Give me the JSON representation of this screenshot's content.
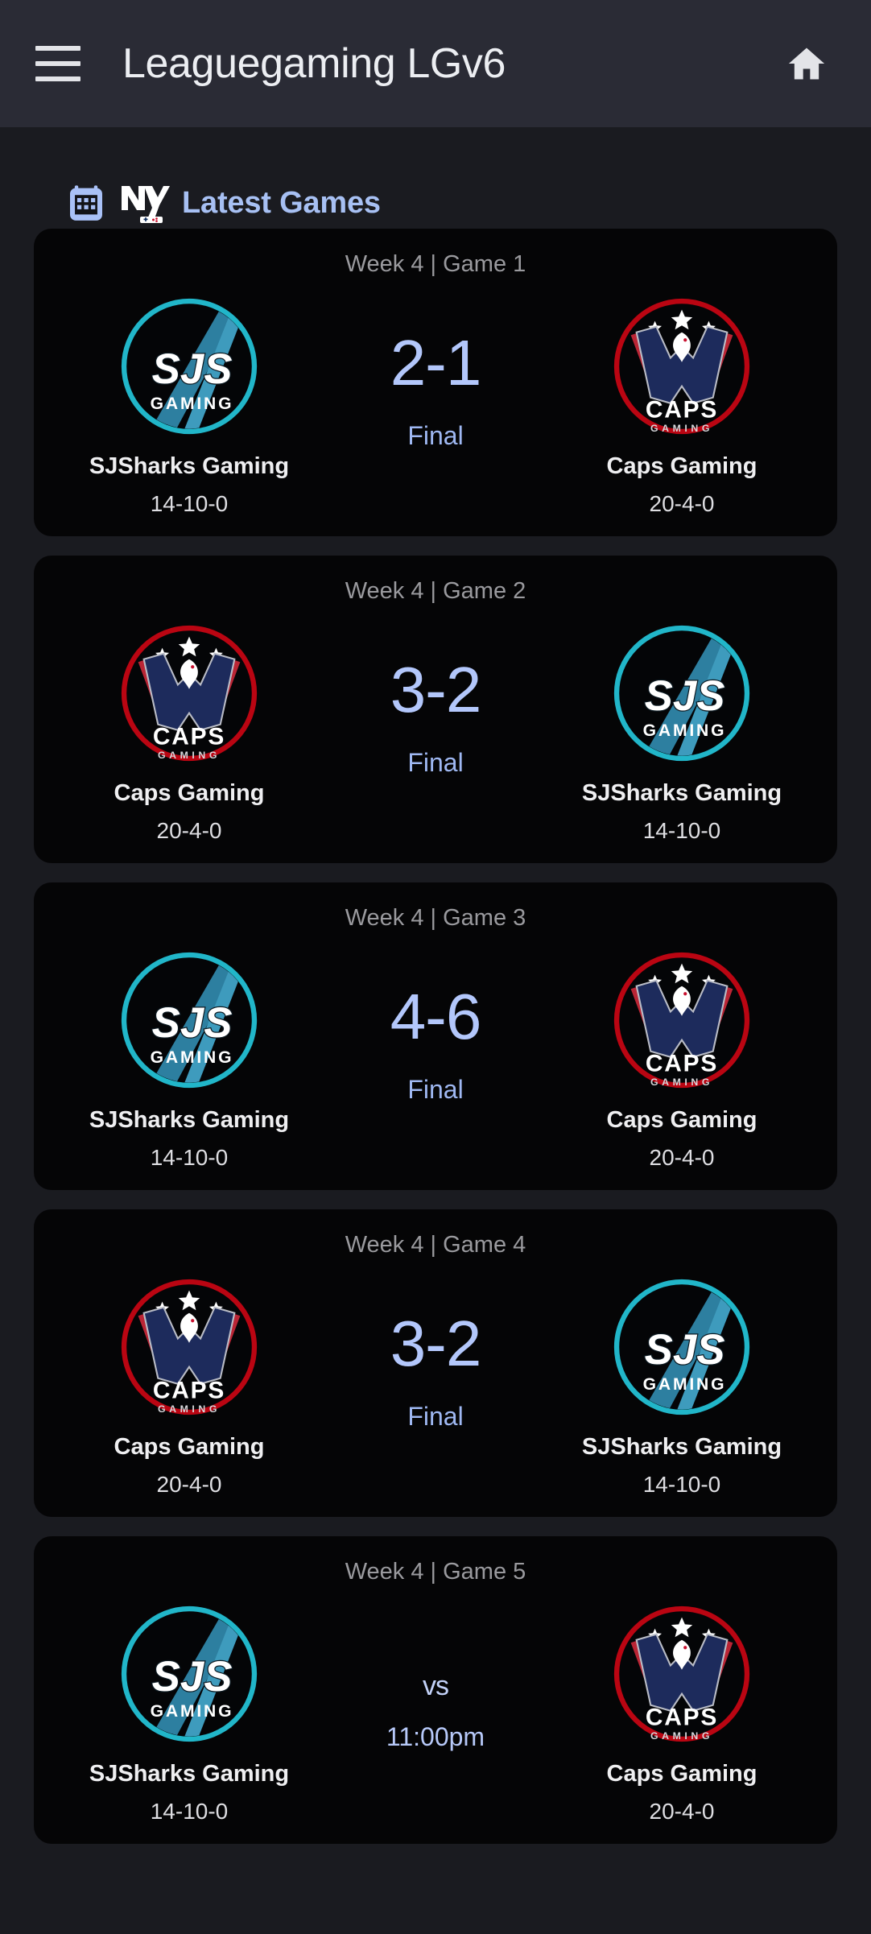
{
  "appbar": {
    "menu_icon": "hamburger-menu-icon",
    "title": "Leaguegaming LGv6",
    "home_icon": "home-icon"
  },
  "section": {
    "calendar_icon": "calendar-icon",
    "league_logo": "ny-league-logo",
    "title": "Latest Games"
  },
  "colors": {
    "appbar_bg": "#2a2b35",
    "page_bg": "#1a1b20",
    "card_bg": "#050506",
    "accent_blue": "#a7c0f3",
    "score_blue": "#b3c7fb",
    "status_blue": "#9fb8f2",
    "meta_gray": "#9a9a9e",
    "sjs_teal": "#21b6c9",
    "caps_red": "#ba0512",
    "caps_navy": "#1d2b5c"
  },
  "games": [
    {
      "meta": "Week 4 | Game 1",
      "score": "2-1",
      "status": "Final",
      "home": {
        "name": "SJSharks Gaming",
        "record": "14-10-0",
        "logo": "sjs"
      },
      "away": {
        "name": "Caps Gaming",
        "record": "20-4-0",
        "logo": "caps"
      }
    },
    {
      "meta": "Week 4 | Game 2",
      "score": "3-2",
      "status": "Final",
      "home": {
        "name": "Caps Gaming",
        "record": "20-4-0",
        "logo": "caps"
      },
      "away": {
        "name": "SJSharks Gaming",
        "record": "14-10-0",
        "logo": "sjs"
      }
    },
    {
      "meta": "Week 4 | Game 3",
      "score": "4-6",
      "status": "Final",
      "home": {
        "name": "SJSharks Gaming",
        "record": "14-10-0",
        "logo": "sjs"
      },
      "away": {
        "name": "Caps Gaming",
        "record": "20-4-0",
        "logo": "caps"
      }
    },
    {
      "meta": "Week 4 | Game 4",
      "score": "3-2",
      "status": "Final",
      "home": {
        "name": "Caps Gaming",
        "record": "20-4-0",
        "logo": "caps"
      },
      "away": {
        "name": "SJSharks Gaming",
        "record": "14-10-0",
        "logo": "sjs"
      }
    },
    {
      "meta": "Week 4 | Game 5",
      "score": "vs",
      "status": "11:00pm",
      "home": {
        "name": "SJSharks Gaming",
        "record": "14-10-0",
        "logo": "sjs"
      },
      "away": {
        "name": "Caps Gaming",
        "record": "20-4-0",
        "logo": "caps"
      }
    }
  ]
}
